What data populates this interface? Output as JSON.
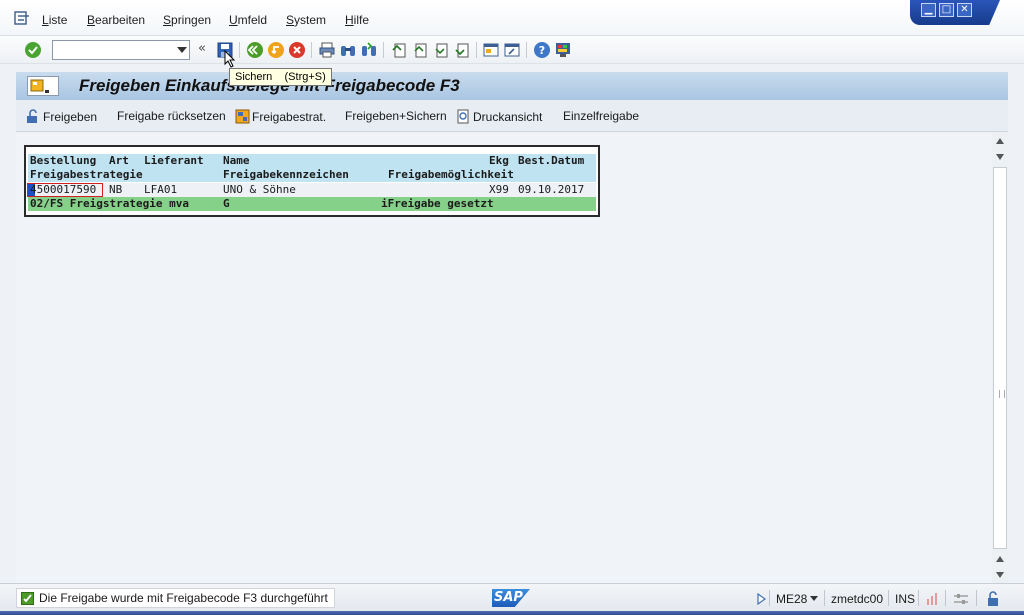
{
  "menu": {
    "items": [
      "Liste",
      "Bearbeiten",
      "Springen",
      "Umfeld",
      "System",
      "Hilfe"
    ]
  },
  "window_controls": [
    "minimize-icon",
    "maximize-icon",
    "close-icon"
  ],
  "toolbar": {
    "command_field_value": "",
    "save_tooltip": "Sichern    (Strg+S)"
  },
  "title": "Freigeben Einkaufsbelege mit Freigabecode F3",
  "app_toolbar": {
    "release": "Freigeben",
    "reset_release": "Freigabe rücksetzen",
    "release_strategy": "Freigabestrat.",
    "release_save": "Freigeben+Sichern",
    "print_preview": "Druckansicht",
    "single_release": "Einzelfreigabe"
  },
  "list": {
    "header1": [
      "Bestellung",
      "Art",
      "Lieferant",
      "Name",
      "Ekg",
      "Best.Datum"
    ],
    "header2": [
      "Freigabestrategie",
      "Freigabekennzeichen",
      "Freigabemöglichkeit"
    ],
    "row1": {
      "order": "4500017590",
      "type": "NB",
      "vendor": "LFA01",
      "name": "UNO & Söhne",
      "purch_group": "X99",
      "date": "09.10.2017"
    },
    "row2": {
      "strategy": "02/FS Freigstrategie mva",
      "indicator": "G",
      "possibility": "iFreigabe gesetzt"
    }
  },
  "status": {
    "message": "Die Freigabe wurde mit Freigabecode F3 durchgeführt",
    "logo": "SAP",
    "transaction": "ME28",
    "server": "zmetdc00",
    "mode": "INS"
  },
  "colors": {
    "header_row": "#bfe3f1",
    "status_row": "#86d18a",
    "title_bar": "#a8c5e2"
  }
}
